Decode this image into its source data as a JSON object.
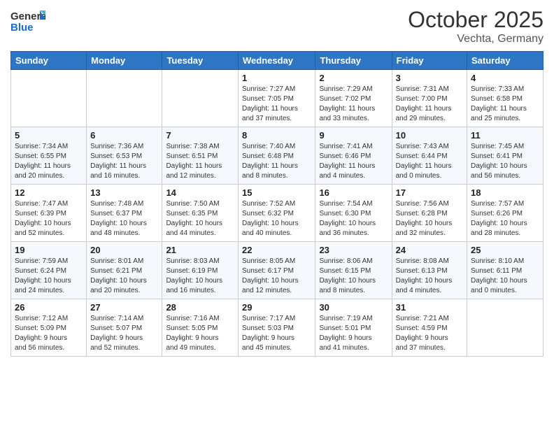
{
  "header": {
    "logo_general": "General",
    "logo_blue": "Blue",
    "month": "October 2025",
    "location": "Vechta, Germany"
  },
  "weekdays": [
    "Sunday",
    "Monday",
    "Tuesday",
    "Wednesday",
    "Thursday",
    "Friday",
    "Saturday"
  ],
  "weeks": [
    [
      {
        "day": "",
        "info": ""
      },
      {
        "day": "",
        "info": ""
      },
      {
        "day": "",
        "info": ""
      },
      {
        "day": "1",
        "info": "Sunrise: 7:27 AM\nSunset: 7:05 PM\nDaylight: 11 hours\nand 37 minutes."
      },
      {
        "day": "2",
        "info": "Sunrise: 7:29 AM\nSunset: 7:02 PM\nDaylight: 11 hours\nand 33 minutes."
      },
      {
        "day": "3",
        "info": "Sunrise: 7:31 AM\nSunset: 7:00 PM\nDaylight: 11 hours\nand 29 minutes."
      },
      {
        "day": "4",
        "info": "Sunrise: 7:33 AM\nSunset: 6:58 PM\nDaylight: 11 hours\nand 25 minutes."
      }
    ],
    [
      {
        "day": "5",
        "info": "Sunrise: 7:34 AM\nSunset: 6:55 PM\nDaylight: 11 hours\nand 20 minutes."
      },
      {
        "day": "6",
        "info": "Sunrise: 7:36 AM\nSunset: 6:53 PM\nDaylight: 11 hours\nand 16 minutes."
      },
      {
        "day": "7",
        "info": "Sunrise: 7:38 AM\nSunset: 6:51 PM\nDaylight: 11 hours\nand 12 minutes."
      },
      {
        "day": "8",
        "info": "Sunrise: 7:40 AM\nSunset: 6:48 PM\nDaylight: 11 hours\nand 8 minutes."
      },
      {
        "day": "9",
        "info": "Sunrise: 7:41 AM\nSunset: 6:46 PM\nDaylight: 11 hours\nand 4 minutes."
      },
      {
        "day": "10",
        "info": "Sunrise: 7:43 AM\nSunset: 6:44 PM\nDaylight: 11 hours\nand 0 minutes."
      },
      {
        "day": "11",
        "info": "Sunrise: 7:45 AM\nSunset: 6:41 PM\nDaylight: 10 hours\nand 56 minutes."
      }
    ],
    [
      {
        "day": "12",
        "info": "Sunrise: 7:47 AM\nSunset: 6:39 PM\nDaylight: 10 hours\nand 52 minutes."
      },
      {
        "day": "13",
        "info": "Sunrise: 7:48 AM\nSunset: 6:37 PM\nDaylight: 10 hours\nand 48 minutes."
      },
      {
        "day": "14",
        "info": "Sunrise: 7:50 AM\nSunset: 6:35 PM\nDaylight: 10 hours\nand 44 minutes."
      },
      {
        "day": "15",
        "info": "Sunrise: 7:52 AM\nSunset: 6:32 PM\nDaylight: 10 hours\nand 40 minutes."
      },
      {
        "day": "16",
        "info": "Sunrise: 7:54 AM\nSunset: 6:30 PM\nDaylight: 10 hours\nand 36 minutes."
      },
      {
        "day": "17",
        "info": "Sunrise: 7:56 AM\nSunset: 6:28 PM\nDaylight: 10 hours\nand 32 minutes."
      },
      {
        "day": "18",
        "info": "Sunrise: 7:57 AM\nSunset: 6:26 PM\nDaylight: 10 hours\nand 28 minutes."
      }
    ],
    [
      {
        "day": "19",
        "info": "Sunrise: 7:59 AM\nSunset: 6:24 PM\nDaylight: 10 hours\nand 24 minutes."
      },
      {
        "day": "20",
        "info": "Sunrise: 8:01 AM\nSunset: 6:21 PM\nDaylight: 10 hours\nand 20 minutes."
      },
      {
        "day": "21",
        "info": "Sunrise: 8:03 AM\nSunset: 6:19 PM\nDaylight: 10 hours\nand 16 minutes."
      },
      {
        "day": "22",
        "info": "Sunrise: 8:05 AM\nSunset: 6:17 PM\nDaylight: 10 hours\nand 12 minutes."
      },
      {
        "day": "23",
        "info": "Sunrise: 8:06 AM\nSunset: 6:15 PM\nDaylight: 10 hours\nand 8 minutes."
      },
      {
        "day": "24",
        "info": "Sunrise: 8:08 AM\nSunset: 6:13 PM\nDaylight: 10 hours\nand 4 minutes."
      },
      {
        "day": "25",
        "info": "Sunrise: 8:10 AM\nSunset: 6:11 PM\nDaylight: 10 hours\nand 0 minutes."
      }
    ],
    [
      {
        "day": "26",
        "info": "Sunrise: 7:12 AM\nSunset: 5:09 PM\nDaylight: 9 hours\nand 56 minutes."
      },
      {
        "day": "27",
        "info": "Sunrise: 7:14 AM\nSunset: 5:07 PM\nDaylight: 9 hours\nand 52 minutes."
      },
      {
        "day": "28",
        "info": "Sunrise: 7:16 AM\nSunset: 5:05 PM\nDaylight: 9 hours\nand 49 minutes."
      },
      {
        "day": "29",
        "info": "Sunrise: 7:17 AM\nSunset: 5:03 PM\nDaylight: 9 hours\nand 45 minutes."
      },
      {
        "day": "30",
        "info": "Sunrise: 7:19 AM\nSunset: 5:01 PM\nDaylight: 9 hours\nand 41 minutes."
      },
      {
        "day": "31",
        "info": "Sunrise: 7:21 AM\nSunset: 4:59 PM\nDaylight: 9 hours\nand 37 minutes."
      },
      {
        "day": "",
        "info": ""
      }
    ]
  ]
}
